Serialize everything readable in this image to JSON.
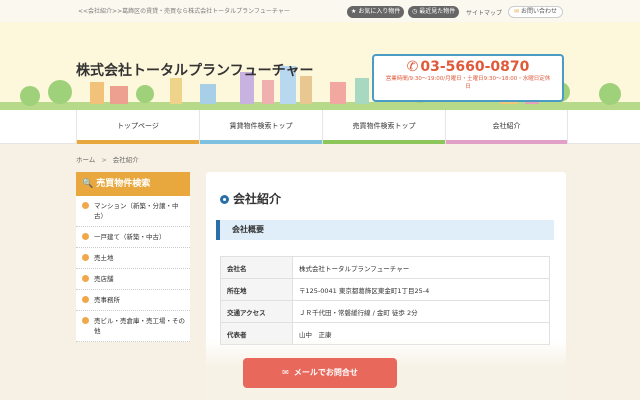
{
  "topbar": {
    "tagline": "<<会社紹介>>葛飾区の賃貸・売買なら株式会社トータルプランフューチャー",
    "favorites_label": "お気に入り物件",
    "recent_label": "最近見た物件",
    "sitemap_label": "サイトマップ",
    "contact_label": "お問い合わせ"
  },
  "header": {
    "company_name": "株式会社トータルプランフューチャー",
    "tel": "03-5660-0870",
    "hours": "営業時間/9:30～19:00/月曜日・土曜日9:30～18:00・水曜日定休日"
  },
  "nav": [
    {
      "label": "トップページ",
      "color": "#e9a83e"
    },
    {
      "label": "賃貸物件検索トップ",
      "color": "#7dc0e0"
    },
    {
      "label": "売買物件検索トップ",
      "color": "#8cc55a"
    },
    {
      "label": "会社紹介",
      "color": "#e0a0c8"
    }
  ],
  "breadcrumb": {
    "home": "ホーム",
    "current": "会社紹介"
  },
  "sidebar": {
    "title": "売買物件検索",
    "items": [
      "マンション（新築・分譲・中古）",
      "一戸建て（新築・中古）",
      "売土地",
      "売店舗",
      "売事務所",
      "売ビル・売倉庫・売工場・その他"
    ]
  },
  "main": {
    "title": "会社紹介",
    "section": "会社概要",
    "rows": [
      {
        "key": "会社名",
        "value": "株式会社トータルプランフューチャー"
      },
      {
        "key": "所在地",
        "value": "〒125-0041 東京都葛飾区東金町1丁目25-4"
      },
      {
        "key": "交通アクセス",
        "value": "ＪＲ千代田・常磐緩行線 / 金町 徒歩 2分"
      },
      {
        "key": "代表者",
        "value": "山中　正康"
      }
    ]
  },
  "cta": {
    "label": "メールでお問合せ"
  },
  "colors": {
    "accent": "#e9a83e",
    "brand_blue": "#2b6fa8",
    "tel_red": "#e05a3a",
    "cta": "#e8695c"
  }
}
